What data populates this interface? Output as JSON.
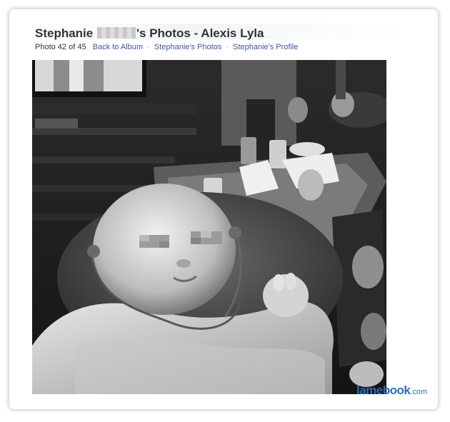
{
  "header": {
    "title_first": "Stephanie",
    "title_rest": "'s Photos - Alexis Lyla"
  },
  "nav": {
    "counter": "Photo 42 of 45",
    "back_to_album": "Back to Album",
    "separator": "·",
    "owner_photos": "Stephanie's Photos",
    "owner_profile": "Stephanie's Profile"
  },
  "watermark": {
    "name": "lamebook",
    "suffix": ".com"
  },
  "colors": {
    "link": "#3b5998",
    "title": "#333333",
    "brand": "#2f6db5"
  }
}
